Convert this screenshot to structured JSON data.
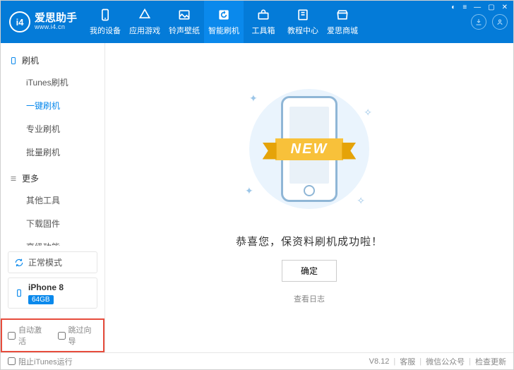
{
  "brand": {
    "logo": "i4",
    "name": "爱思助手",
    "url": "www.i4.cn"
  },
  "nav": {
    "items": [
      {
        "label": "我的设备"
      },
      {
        "label": "应用游戏"
      },
      {
        "label": "铃声壁纸"
      },
      {
        "label": "智能刷机"
      },
      {
        "label": "工具箱"
      },
      {
        "label": "教程中心"
      },
      {
        "label": "爱思商城"
      }
    ]
  },
  "sidebar": {
    "group1": {
      "title": "刷机",
      "items": [
        {
          "label": "iTunes刷机"
        },
        {
          "label": "一键刷机"
        },
        {
          "label": "专业刷机"
        },
        {
          "label": "批量刷机"
        }
      ]
    },
    "group2": {
      "title": "更多",
      "items": [
        {
          "label": "其他工具"
        },
        {
          "label": "下载固件"
        },
        {
          "label": "高级功能"
        }
      ]
    },
    "mode": "正常模式",
    "device": {
      "name": "iPhone 8",
      "capacity": "64GB"
    },
    "checks": {
      "auto_activate": "自动激活",
      "skip_guide": "跳过向导"
    }
  },
  "main": {
    "ribbon": "NEW",
    "message": "恭喜您，保资料刷机成功啦！",
    "ok": "确定",
    "view_log": "查看日志"
  },
  "footer": {
    "block_itunes": "阻止iTunes运行",
    "version": "V8.12",
    "support": "客服",
    "wechat": "微信公众号",
    "check_update": "检查更新"
  }
}
